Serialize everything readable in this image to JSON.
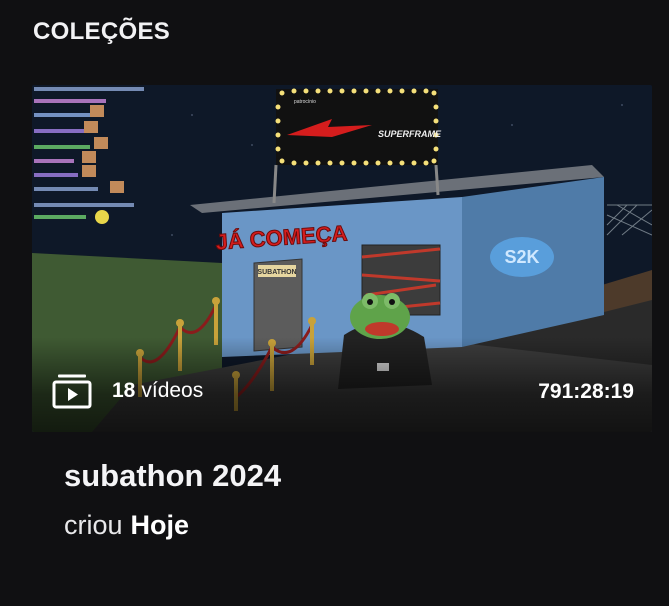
{
  "section": {
    "title": "COLEÇÕES"
  },
  "collection": {
    "title": "subathon 2024",
    "video_count": "18",
    "video_label": "vídeos",
    "duration": "791:28:19",
    "created_label": "criou",
    "created_value": "Hoje",
    "thumbnail": {
      "sign_text": "JÁ COMEÇA",
      "door_text": "SUBATHON",
      "marquee_small": "patrocínio",
      "marquee_brand": "SUPERFRAME",
      "graffiti": "S2K"
    }
  },
  "colors": {
    "background": "#101012",
    "text": "#ffffff"
  },
  "icons": {
    "playlist": "playlist-play-icon"
  }
}
